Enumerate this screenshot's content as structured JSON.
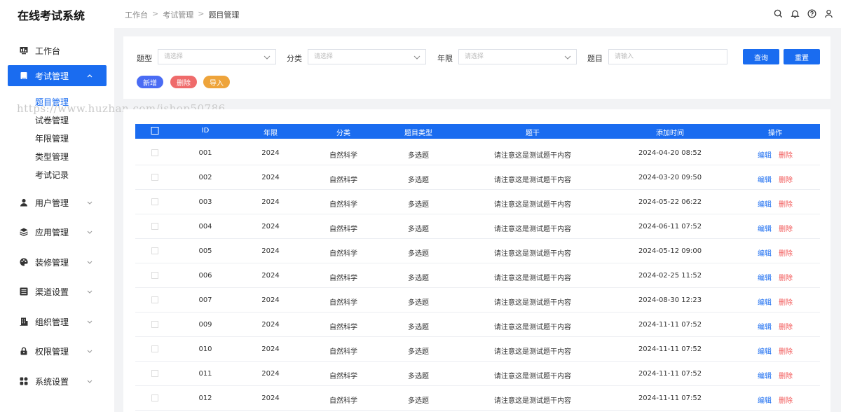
{
  "app": {
    "title": "在线考试系统"
  },
  "breadcrumb": [
    "工作台",
    "考试管理",
    "题目管理"
  ],
  "header_icons": [
    "search-icon",
    "bell-icon",
    "help-icon",
    "user-icon"
  ],
  "sidebar": {
    "items": [
      {
        "label": "工作台",
        "icon": "monitor-icon"
      },
      {
        "label": "考试管理",
        "icon": "book-icon",
        "active": true,
        "expanded": true
      },
      {
        "label": "用户管理",
        "icon": "user-icon"
      },
      {
        "label": "应用管理",
        "icon": "layers-icon"
      },
      {
        "label": "装修管理",
        "icon": "palette-icon"
      },
      {
        "label": "渠道设置",
        "icon": "list-icon"
      },
      {
        "label": "组织管理",
        "icon": "building-icon"
      },
      {
        "label": "权限管理",
        "icon": "lock-icon"
      },
      {
        "label": "系统设置",
        "icon": "grid-icon"
      }
    ],
    "sub_items": [
      {
        "label": "题目管理",
        "active": true
      },
      {
        "label": "试卷管理"
      },
      {
        "label": "年限管理"
      },
      {
        "label": "类型管理"
      },
      {
        "label": "考试记录"
      }
    ]
  },
  "filters": {
    "type": {
      "label": "题型",
      "placeholder": "请选择"
    },
    "category": {
      "label": "分类",
      "placeholder": "请选择"
    },
    "year": {
      "label": "年限",
      "placeholder": "请选择"
    },
    "stem": {
      "label": "题目",
      "placeholder": "请输入"
    },
    "query_label": "查询",
    "reset_label": "重置"
  },
  "actions": {
    "add_label": "新增",
    "delete_label": "删除",
    "import_label": "导入"
  },
  "watermark": "https://www.huzhan.com/ishop50786",
  "table": {
    "columns": [
      "ID",
      "年限",
      "分类",
      "题目类型",
      "题干",
      "添加时间",
      "操作"
    ],
    "edit_label": "编辑",
    "delete_label": "删除",
    "rows": [
      {
        "id": "001",
        "year": "2024",
        "category": "自然科学",
        "qtype": "多选题",
        "stem": "请注意这是测试题干内容",
        "time": "2024-04-20  08:52"
      },
      {
        "id": "002",
        "year": "2024",
        "category": "自然科学",
        "qtype": "多选题",
        "stem": "请注意这是测试题干内容",
        "time": "2024-03-20  09:50"
      },
      {
        "id": "003",
        "year": "2024",
        "category": "自然科学",
        "qtype": "多选题",
        "stem": "请注意这是测试题干内容",
        "time": "2024-05-22  06:22"
      },
      {
        "id": "004",
        "year": "2024",
        "category": "自然科学",
        "qtype": "多选题",
        "stem": "请注意这是测试题干内容",
        "time": "2024-06-11  07:52"
      },
      {
        "id": "005",
        "year": "2024",
        "category": "自然科学",
        "qtype": "多选题",
        "stem": "请注意这是测试题干内容",
        "time": "2024-05-12  09:00"
      },
      {
        "id": "006",
        "year": "2024",
        "category": "自然科学",
        "qtype": "多选题",
        "stem": "请注意这是测试题干内容",
        "time": "2024-02-25  11:52"
      },
      {
        "id": "007",
        "year": "2024",
        "category": "自然科学",
        "qtype": "多选题",
        "stem": "请注意这是测试题干内容",
        "time": "2024-08-30  12:23"
      },
      {
        "id": "009",
        "year": "2024",
        "category": "自然科学",
        "qtype": "多选题",
        "stem": "请注意这是测试题干内容",
        "time": "2024-11-11  07:52"
      },
      {
        "id": "010",
        "year": "2024",
        "category": "自然科学",
        "qtype": "多选题",
        "stem": "请注意这是测试题干内容",
        "time": "2024-11-11  07:52"
      },
      {
        "id": "011",
        "year": "2024",
        "category": "自然科学",
        "qtype": "多选题",
        "stem": "请注意这是测试题干内容",
        "time": "2024-11-11  07:52"
      },
      {
        "id": "012",
        "year": "2024",
        "category": "自然科学",
        "qtype": "多选题",
        "stem": "请注意这是测试题干内容",
        "time": "2024-11-11  07:52"
      }
    ]
  }
}
